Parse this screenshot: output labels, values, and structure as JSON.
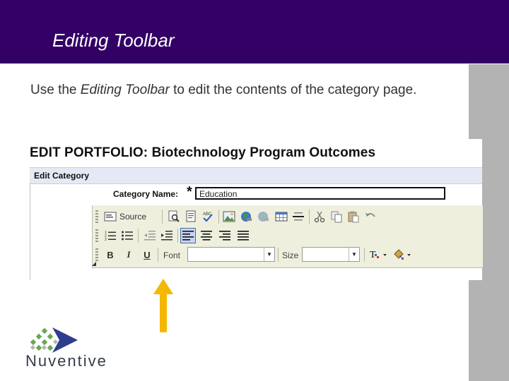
{
  "slide": {
    "title": "Editing Toolbar",
    "body_pre": "Use the ",
    "body_em": "Editing Toolbar",
    "body_post": " to edit the contents of the category page."
  },
  "screenshot": {
    "heading": "EDIT PORTFOLIO: Biotechnology Program Outcomes",
    "section": "Edit Category",
    "category_label": "Category Name:",
    "required_mark": "*",
    "category_value": "Education",
    "toolbar": {
      "source_label": "Source",
      "font_label": "Font",
      "size_label": "Size",
      "bold": "B",
      "italic": "I",
      "underline": "U"
    }
  },
  "logo": {
    "text": "Nuventive"
  },
  "colors": {
    "header": "#330066",
    "arrow": "#f5b800",
    "side_strip": "#b3b3b3"
  }
}
